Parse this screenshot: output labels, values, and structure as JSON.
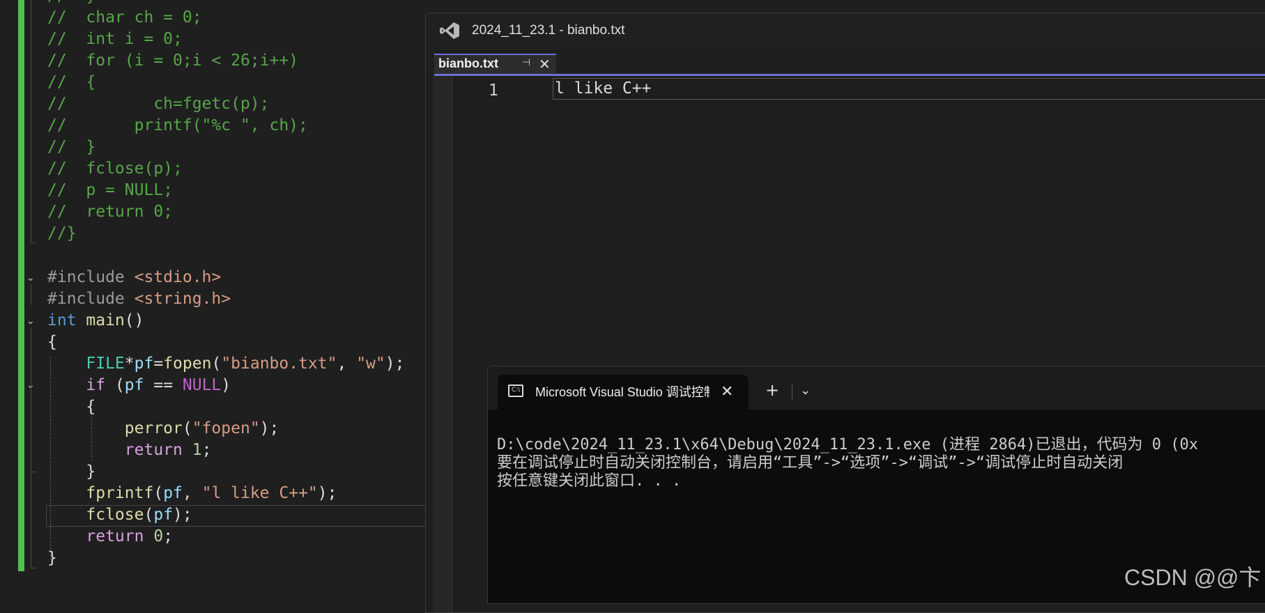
{
  "editor": {
    "lines": [
      {
        "id": "l00",
        "segments": [
          {
            "c": "cm",
            "t": "//  }"
          }
        ]
      },
      {
        "id": "l01",
        "segments": [
          {
            "c": "cm",
            "t": "//  char ch = 0;"
          }
        ]
      },
      {
        "id": "l02",
        "segments": [
          {
            "c": "cm",
            "t": "//  int i = 0;"
          }
        ]
      },
      {
        "id": "l03",
        "segments": [
          {
            "c": "cm",
            "t": "//  for (i = 0;i < 26;i++)"
          }
        ]
      },
      {
        "id": "l04",
        "segments": [
          {
            "c": "cm",
            "t": "//  {"
          }
        ]
      },
      {
        "id": "l05",
        "segments": [
          {
            "c": "cm",
            "t": "//         ch=fgetc(p);"
          }
        ]
      },
      {
        "id": "l06",
        "segments": [
          {
            "c": "cm",
            "t": "//       printf(\"%c \", ch);"
          }
        ]
      },
      {
        "id": "l07",
        "segments": [
          {
            "c": "cm",
            "t": "//  }"
          }
        ]
      },
      {
        "id": "l08",
        "segments": [
          {
            "c": "cm",
            "t": "//  fclose(p);"
          }
        ]
      },
      {
        "id": "l09",
        "segments": [
          {
            "c": "cm",
            "t": "//  p = NULL;"
          }
        ]
      },
      {
        "id": "l10",
        "segments": [
          {
            "c": "cm",
            "t": "//  return 0;"
          }
        ]
      },
      {
        "id": "l11",
        "segments": [
          {
            "c": "cm",
            "t": "//}"
          }
        ]
      },
      {
        "id": "l12",
        "segments": []
      },
      {
        "id": "l13",
        "segments": [
          {
            "c": "pp",
            "t": "#include "
          },
          {
            "c": "inc",
            "t": "<stdio.h>"
          }
        ]
      },
      {
        "id": "l14",
        "segments": [
          {
            "c": "pp",
            "t": "#include "
          },
          {
            "c": "inc",
            "t": "<string.h>"
          }
        ]
      },
      {
        "id": "l15",
        "segments": [
          {
            "c": "kw",
            "t": "int"
          },
          {
            "c": "",
            "t": " "
          },
          {
            "c": "fn",
            "t": "main"
          },
          {
            "c": "",
            "t": "()"
          }
        ]
      },
      {
        "id": "l16",
        "segments": [
          {
            "c": "",
            "t": "{"
          }
        ]
      },
      {
        "id": "l17",
        "segments": [
          {
            "c": "",
            "t": "    "
          },
          {
            "c": "ty",
            "t": "FILE"
          },
          {
            "c": "",
            "t": "*"
          },
          {
            "c": "var",
            "t": "pf"
          },
          {
            "c": "",
            "t": "="
          },
          {
            "c": "fn",
            "t": "fopen"
          },
          {
            "c": "",
            "t": "("
          },
          {
            "c": "str",
            "t": "\"bianbo.txt\""
          },
          {
            "c": "",
            "t": ", "
          },
          {
            "c": "str",
            "t": "\"w\""
          },
          {
            "c": "",
            "t": ");"
          }
        ]
      },
      {
        "id": "l18",
        "segments": [
          {
            "c": "",
            "t": "    "
          },
          {
            "c": "kwc",
            "t": "if"
          },
          {
            "c": "",
            "t": " ("
          },
          {
            "c": "var",
            "t": "pf"
          },
          {
            "c": "",
            "t": " == "
          },
          {
            "c": "mac",
            "t": "NULL"
          },
          {
            "c": "",
            "t": ")"
          }
        ]
      },
      {
        "id": "l19",
        "segments": [
          {
            "c": "",
            "t": "    {"
          }
        ]
      },
      {
        "id": "l20",
        "segments": [
          {
            "c": "",
            "t": "        "
          },
          {
            "c": "fn",
            "t": "perror"
          },
          {
            "c": "",
            "t": "("
          },
          {
            "c": "str",
            "t": "\"fopen\""
          },
          {
            "c": "",
            "t": ");"
          }
        ]
      },
      {
        "id": "l21",
        "segments": [
          {
            "c": "",
            "t": "        "
          },
          {
            "c": "kwc",
            "t": "return"
          },
          {
            "c": "",
            "t": " "
          },
          {
            "c": "num",
            "t": "1"
          },
          {
            "c": "",
            "t": ";"
          }
        ]
      },
      {
        "id": "l22",
        "segments": [
          {
            "c": "",
            "t": "    }"
          }
        ]
      },
      {
        "id": "l23",
        "segments": [
          {
            "c": "",
            "t": "    "
          },
          {
            "c": "fn",
            "t": "fprintf"
          },
          {
            "c": "",
            "t": "("
          },
          {
            "c": "var",
            "t": "pf"
          },
          {
            "c": "",
            "t": ", "
          },
          {
            "c": "str",
            "t": "\"l like C++\""
          },
          {
            "c": "",
            "t": ");"
          }
        ]
      },
      {
        "id": "l24",
        "segments": [
          {
            "c": "",
            "t": "    "
          },
          {
            "c": "fn",
            "t": "fclose"
          },
          {
            "c": "",
            "t": "("
          },
          {
            "c": "var",
            "t": "pf"
          },
          {
            "c": "",
            "t": ");"
          }
        ]
      },
      {
        "id": "l25",
        "segments": [
          {
            "c": "",
            "t": "    "
          },
          {
            "c": "kwc",
            "t": "return"
          },
          {
            "c": "",
            "t": " "
          },
          {
            "c": "num",
            "t": "0"
          },
          {
            "c": "",
            "t": ";"
          }
        ]
      },
      {
        "id": "l26",
        "segments": [
          {
            "c": "",
            "t": "}"
          }
        ]
      }
    ]
  },
  "notepad": {
    "title": "2024_11_23.1 - bianbo.txt",
    "tab_label": "bianbo.txt",
    "pin_glyph": "⊣",
    "close_glyph": "✕",
    "line_number": "1",
    "line_text": "l like C++"
  },
  "console": {
    "tab_title": "Microsoft Visual Studio 调试控制台",
    "icon_text": "C:\\",
    "close_glyph": "✕",
    "new_tab_glyph": "+",
    "dropdown_glyph": "⌄",
    "lines": [
      "D:\\code\\2024_11_23.1\\x64\\Debug\\2024_11_23.1.exe (进程 2864)已退出，代码为 0 (0x",
      "要在调试停止时自动关闭控制台，请启用“工具”->“选项”->“调试”->“调试停止时自动关闭",
      "按任意键关闭此窗口. . ."
    ]
  },
  "watermark": "CSDN @@卞",
  "colors": {
    "accent": "#6f6fd6",
    "change_bar": "#4ec24e",
    "comment": "#57a64a"
  }
}
